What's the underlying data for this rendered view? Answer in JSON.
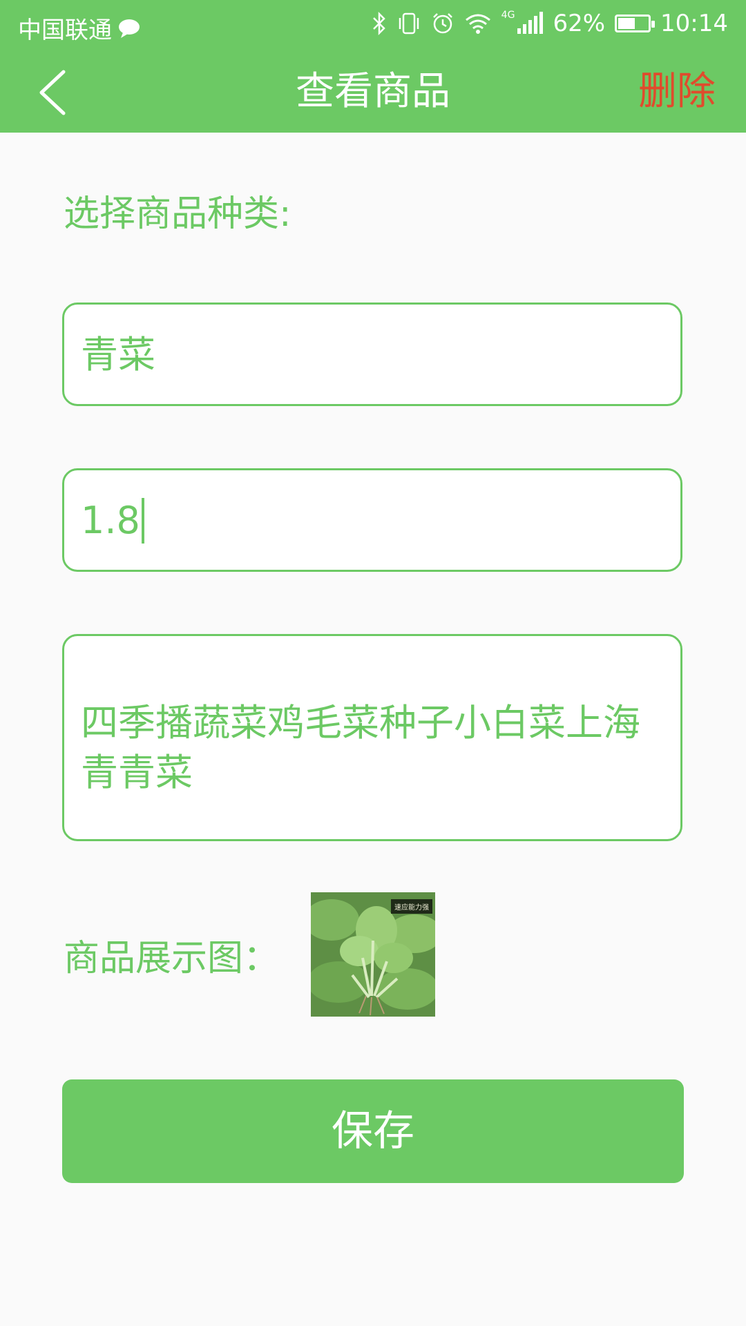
{
  "status_bar": {
    "carrier": "中国联通",
    "network": "4G",
    "battery": "62%",
    "battery_level": 0.62,
    "time": "10:14"
  },
  "nav": {
    "title": "查看商品",
    "delete_label": "删除"
  },
  "form": {
    "category_label": "选择商品种类:",
    "category_value": "青菜",
    "price_value": "1.8",
    "description_value": "四季播蔬菜鸡毛菜种子小白菜上海青青菜",
    "image_label": "商品展示图：",
    "image_watermark": "速应能力强"
  },
  "save_label": "保存",
  "colors": {
    "accent": "#6cc964",
    "delete": "#e04b2c",
    "background": "#fafafa"
  }
}
